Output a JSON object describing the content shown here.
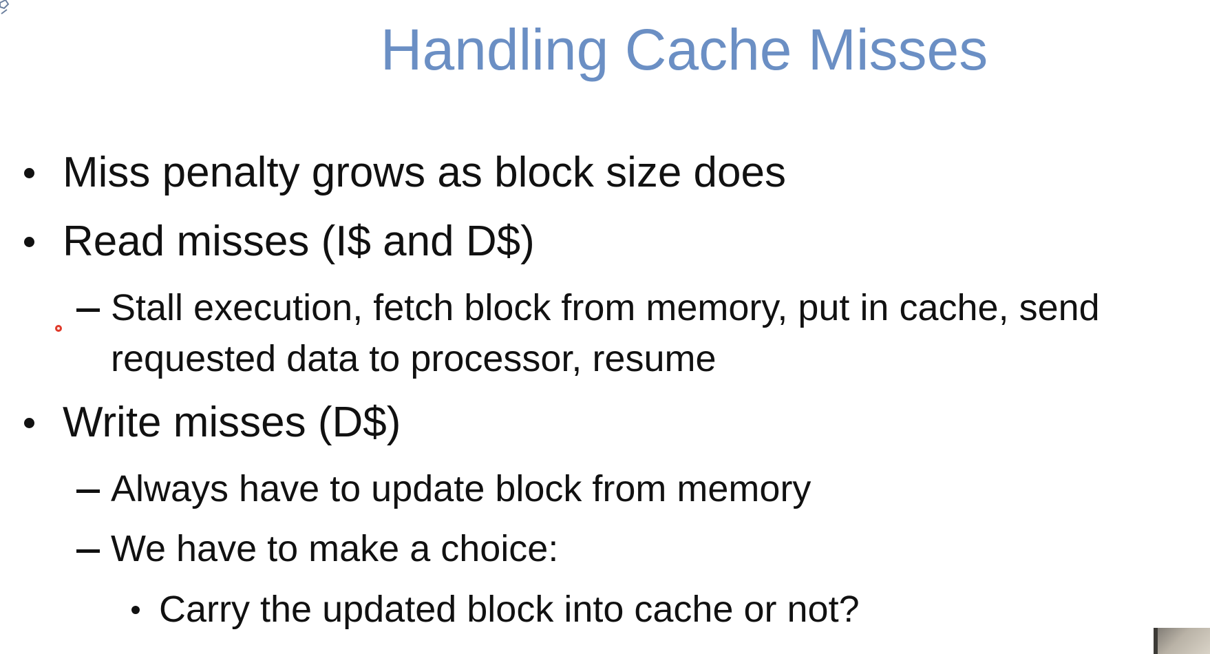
{
  "title": "Handling Cache Misses",
  "bullets": [
    {
      "text": "Miss penalty grows as block size does"
    },
    {
      "text": "Read misses (I$ and D$)"
    },
    {
      "line1": "Stall execution, fetch block from memory, put in cache, send",
      "line2": "requested data to processor, resume"
    },
    {
      "text": "Write misses (D$)"
    },
    {
      "text": "Always have to update block from memory"
    },
    {
      "text": "We have to make a choice:"
    },
    {
      "text": "Carry the updated block into cache or not?"
    }
  ],
  "colors": {
    "title": "#6b8fc4",
    "body_text": "#111111",
    "cursor": "#e03a2a"
  },
  "icons": {
    "corner": "slide-logo-icon",
    "cursor": "pointer-cursor-icon"
  }
}
